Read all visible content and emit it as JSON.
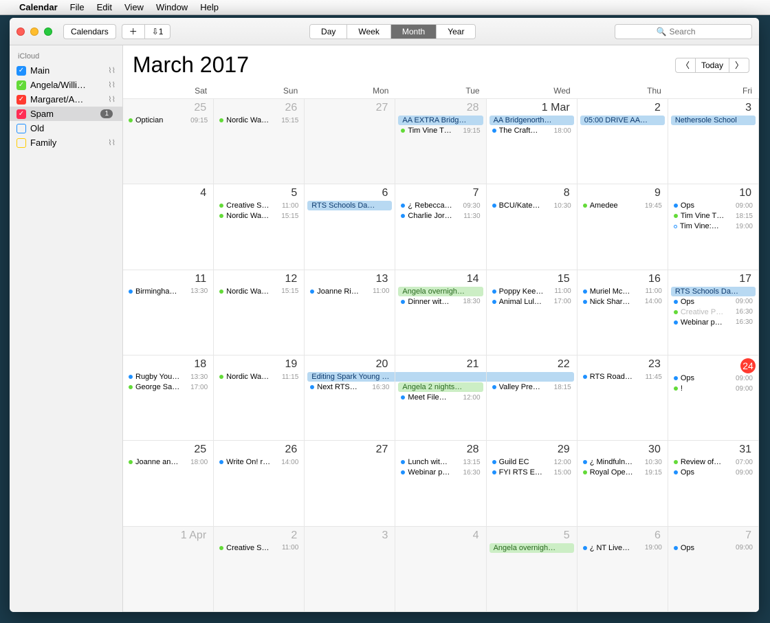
{
  "menubar": {
    "app": "Calendar",
    "items": [
      "File",
      "Edit",
      "View",
      "Window",
      "Help"
    ]
  },
  "toolbar": {
    "calendars": "Calendars",
    "inbox": "1",
    "views": [
      "Day",
      "Week",
      "Month",
      "Year"
    ],
    "active_view": "Month",
    "search_placeholder": "Search"
  },
  "sidebar": {
    "section": "iCloud",
    "items": [
      {
        "label": "Main",
        "color": "#1e90ff",
        "checked": true,
        "shared": true
      },
      {
        "label": "Angela/Willi…",
        "color": "#63da38",
        "checked": true,
        "shared": true
      },
      {
        "label": "Margaret/A…",
        "color": "#ff3b30",
        "checked": true,
        "shared": true
      },
      {
        "label": "Spam",
        "color": "#ff2d55",
        "checked": true,
        "selected": true,
        "badge": "1"
      },
      {
        "label": "Old",
        "color": "#1e90ff",
        "checked": false
      },
      {
        "label": "Family",
        "color": "#ffcc00",
        "checked": false,
        "shared": true
      }
    ]
  },
  "header": {
    "month": "March",
    "year": "2017",
    "today": "Today"
  },
  "dayheaders": [
    "Sat",
    "Sun",
    "Mon",
    "Tue",
    "Wed",
    "Thu",
    "Fri"
  ],
  "weeks": [
    [
      {
        "num": "25",
        "dim": true,
        "events": [
          {
            "type": "dot",
            "title": "Optician",
            "time": "09:15",
            "cal": "green"
          }
        ]
      },
      {
        "num": "26",
        "dim": true,
        "events": [
          {
            "type": "dot",
            "title": "Nordic Wa…",
            "time": "15:15",
            "cal": "green"
          }
        ]
      },
      {
        "num": "27",
        "dim": true,
        "events": []
      },
      {
        "num": "28",
        "dim": true,
        "events": [
          {
            "type": "bar",
            "title": "AA EXTRA Bridg…",
            "cal": "blue"
          },
          {
            "type": "dot",
            "title": "Tim Vine T…",
            "time": "19:15",
            "cal": "green"
          }
        ]
      },
      {
        "num": "1 Mar",
        "events": [
          {
            "type": "bar",
            "title": "AA Bridgenorth…",
            "cal": "blue"
          },
          {
            "type": "dot",
            "title": "The Craft…",
            "time": "18:00",
            "cal": "blue"
          }
        ]
      },
      {
        "num": "2",
        "events": [
          {
            "type": "bar",
            "title": "05:00 DRIVE AA…",
            "cal": "blue"
          }
        ]
      },
      {
        "num": "3",
        "events": [
          {
            "type": "bar",
            "title": "Nethersole School",
            "cal": "blue"
          }
        ]
      }
    ],
    [
      {
        "num": "4",
        "events": []
      },
      {
        "num": "5",
        "events": [
          {
            "type": "dot",
            "title": "Creative S…",
            "time": "11:00",
            "cal": "green"
          },
          {
            "type": "dot",
            "title": "Nordic Wa…",
            "time": "15:15",
            "cal": "green"
          }
        ]
      },
      {
        "num": "6",
        "events": [
          {
            "type": "bar",
            "title": "RTS Schools Da…",
            "cal": "blue"
          }
        ]
      },
      {
        "num": "7",
        "events": [
          {
            "type": "dot",
            "title": "¿ Rebecca…",
            "time": "09:30",
            "cal": "blue"
          },
          {
            "type": "dot",
            "title": "Charlie Jor…",
            "time": "11:30",
            "cal": "blue"
          }
        ]
      },
      {
        "num": "8",
        "events": [
          {
            "type": "dot",
            "title": "BCU/Kate…",
            "time": "10:30",
            "cal": "blue"
          }
        ]
      },
      {
        "num": "9",
        "events": [
          {
            "type": "dot",
            "title": "Amedee",
            "time": "19:45",
            "cal": "green"
          }
        ]
      },
      {
        "num": "10",
        "events": [
          {
            "type": "dot",
            "title": "Ops",
            "time": "09:00",
            "cal": "blue"
          },
          {
            "type": "dot",
            "title": "Tim Vine T…",
            "time": "18:15",
            "cal": "green"
          },
          {
            "type": "dot",
            "title": "Tim Vine:…",
            "time": "19:00",
            "cal": "blue-o"
          }
        ]
      }
    ],
    [
      {
        "num": "11",
        "events": [
          {
            "type": "dot",
            "title": "Birmingha…",
            "time": "13:30",
            "cal": "blue"
          }
        ]
      },
      {
        "num": "12",
        "events": [
          {
            "type": "dot",
            "title": "Nordic Wa…",
            "time": "15:15",
            "cal": "green"
          }
        ]
      },
      {
        "num": "13",
        "events": [
          {
            "type": "dot",
            "title": "Joanne Ri…",
            "time": "11:00",
            "cal": "blue"
          }
        ]
      },
      {
        "num": "14",
        "events": [
          {
            "type": "bar",
            "title": "Angela overnigh…",
            "cal": "green"
          },
          {
            "type": "dot",
            "title": "Dinner wit…",
            "time": "18:30",
            "cal": "blue"
          }
        ]
      },
      {
        "num": "15",
        "events": [
          {
            "type": "dot",
            "title": "Poppy Kee…",
            "time": "11:00",
            "cal": "blue"
          },
          {
            "type": "dot",
            "title": "Animal Lul…",
            "time": "17:00",
            "cal": "blue"
          }
        ]
      },
      {
        "num": "16",
        "events": [
          {
            "type": "dot",
            "title": "Muriel Mc…",
            "time": "11:00",
            "cal": "blue"
          },
          {
            "type": "dot",
            "title": "Nick Shar…",
            "time": "14:00",
            "cal": "blue"
          }
        ]
      },
      {
        "num": "17",
        "events": [
          {
            "type": "bar",
            "title": "RTS Schools Da…",
            "cal": "blue"
          },
          {
            "type": "dot",
            "title": "Ops",
            "time": "09:00",
            "cal": "blue"
          },
          {
            "type": "dot",
            "title": "Creative P…",
            "time": "16:30",
            "cal": "green",
            "faded": true
          },
          {
            "type": "dot",
            "title": "Webinar p…",
            "time": "16:30",
            "cal": "blue"
          }
        ]
      }
    ],
    [
      {
        "num": "18",
        "events": [
          {
            "type": "dot",
            "title": "Rugby You…",
            "time": "13:30",
            "cal": "blue"
          },
          {
            "type": "dot",
            "title": "George Sa…",
            "time": "17:00",
            "cal": "green"
          }
        ]
      },
      {
        "num": "19",
        "events": [
          {
            "type": "dot",
            "title": "Nordic Wa…",
            "time": "11:15",
            "cal": "green"
          }
        ]
      },
      {
        "num": "20",
        "span": "start",
        "events": [
          {
            "type": "spanbar",
            "title": "Editing Spark Young Writers magazine",
            "cal": "blue",
            "pos": "start"
          },
          {
            "type": "dot",
            "title": "Next RTS…",
            "time": "16:30",
            "cal": "blue"
          }
        ]
      },
      {
        "num": "21",
        "events": [
          {
            "type": "spanbar",
            "title": "",
            "cal": "blue",
            "pos": "mid"
          },
          {
            "type": "bar",
            "title": "Angela 2 nights…",
            "cal": "green"
          },
          {
            "type": "dot",
            "title": "Meet File…",
            "time": "12:00",
            "cal": "blue"
          }
        ]
      },
      {
        "num": "22",
        "events": [
          {
            "type": "spanbar",
            "title": "",
            "cal": "blue",
            "pos": "end"
          },
          {
            "type": "dot",
            "title": "Valley Pre…",
            "time": "18:15",
            "cal": "blue"
          }
        ]
      },
      {
        "num": "23",
        "events": [
          {
            "type": "dot",
            "title": "RTS Road…",
            "time": "11:45",
            "cal": "blue"
          }
        ]
      },
      {
        "num": "24",
        "today": true,
        "events": [
          {
            "type": "dot",
            "title": "Ops",
            "time": "09:00",
            "cal": "blue"
          },
          {
            "type": "dot",
            "title": "!",
            "time": "09:00",
            "cal": "green"
          }
        ]
      }
    ],
    [
      {
        "num": "25",
        "events": [
          {
            "type": "dot",
            "title": "Joanne an…",
            "time": "18:00",
            "cal": "green"
          }
        ]
      },
      {
        "num": "26",
        "events": [
          {
            "type": "dot",
            "title": "Write On! r…",
            "time": "14:00",
            "cal": "blue"
          }
        ]
      },
      {
        "num": "27",
        "events": []
      },
      {
        "num": "28",
        "events": [
          {
            "type": "dot",
            "title": "Lunch wit…",
            "time": "13:15",
            "cal": "blue"
          },
          {
            "type": "dot",
            "title": "Webinar p…",
            "time": "16:30",
            "cal": "blue"
          }
        ]
      },
      {
        "num": "29",
        "events": [
          {
            "type": "dot",
            "title": "Guild EC",
            "time": "12:00",
            "cal": "blue"
          },
          {
            "type": "dot",
            "title": "FYI RTS E…",
            "time": "15:00",
            "cal": "blue"
          }
        ]
      },
      {
        "num": "30",
        "events": [
          {
            "type": "dot",
            "title": "¿ Mindfuln…",
            "time": "10:30",
            "cal": "blue"
          },
          {
            "type": "dot",
            "title": "Royal Ope…",
            "time": "19:15",
            "cal": "green"
          }
        ]
      },
      {
        "num": "31",
        "events": [
          {
            "type": "dot",
            "title": "Review of…",
            "time": "07:00",
            "cal": "green"
          },
          {
            "type": "dot",
            "title": "Ops",
            "time": "09:00",
            "cal": "blue"
          }
        ]
      }
    ],
    [
      {
        "num": "1 Apr",
        "dim": true,
        "events": []
      },
      {
        "num": "2",
        "dim": true,
        "events": [
          {
            "type": "dot",
            "title": "Creative S…",
            "time": "11:00",
            "cal": "green"
          }
        ]
      },
      {
        "num": "3",
        "dim": true,
        "events": []
      },
      {
        "num": "4",
        "dim": true,
        "events": []
      },
      {
        "num": "5",
        "dim": true,
        "events": [
          {
            "type": "bar",
            "title": "Angela overnigh…",
            "cal": "green"
          }
        ]
      },
      {
        "num": "6",
        "dim": true,
        "events": [
          {
            "type": "dot",
            "title": "¿ NT Live…",
            "time": "19:00",
            "cal": "blue"
          }
        ]
      },
      {
        "num": "7",
        "dim": true,
        "events": [
          {
            "type": "dot",
            "title": "Ops",
            "time": "09:00",
            "cal": "blue"
          }
        ]
      }
    ]
  ]
}
